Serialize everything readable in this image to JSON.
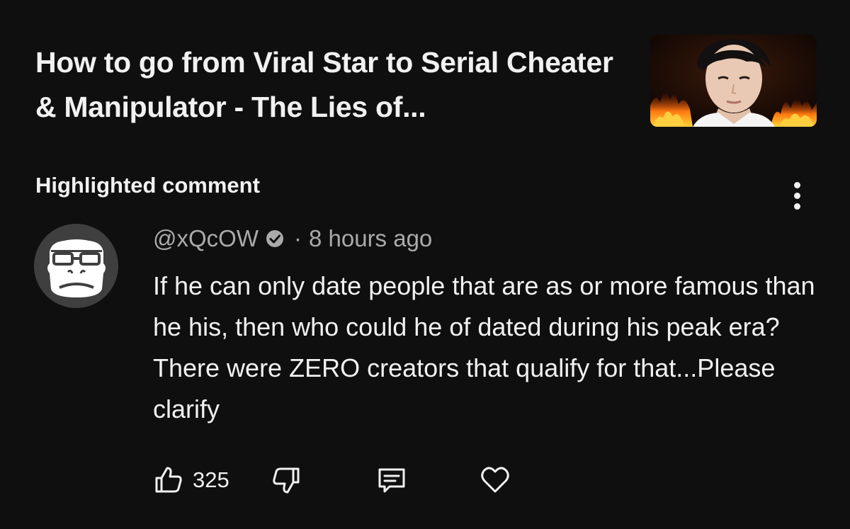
{
  "video": {
    "title": "How to go from Viral Star to Serial Cheater & Manipulator - The Lies of..."
  },
  "section": {
    "label": "Highlighted comment"
  },
  "comment": {
    "author": "@xQcOW",
    "verified": true,
    "separator": "·",
    "timestamp": "8 hours ago",
    "text": "If he can only date people that are as or more famous than he his, then who could he of dated during his peak era? There were ZERO creators that qualify for that...Please clarify"
  },
  "actions": {
    "like_count": "325"
  },
  "icons": {
    "like": "thumbs-up-icon",
    "dislike": "thumbs-down-icon",
    "reply": "reply-icon",
    "heart": "heart-icon",
    "menu": "more-vertical-icon",
    "verified": "verified-check-icon"
  },
  "colors": {
    "background": "#0f0f0f",
    "text_primary": "#f1f1f1",
    "text_secondary": "#aaaaaa",
    "avatar_bg": "#3f3f3f"
  }
}
